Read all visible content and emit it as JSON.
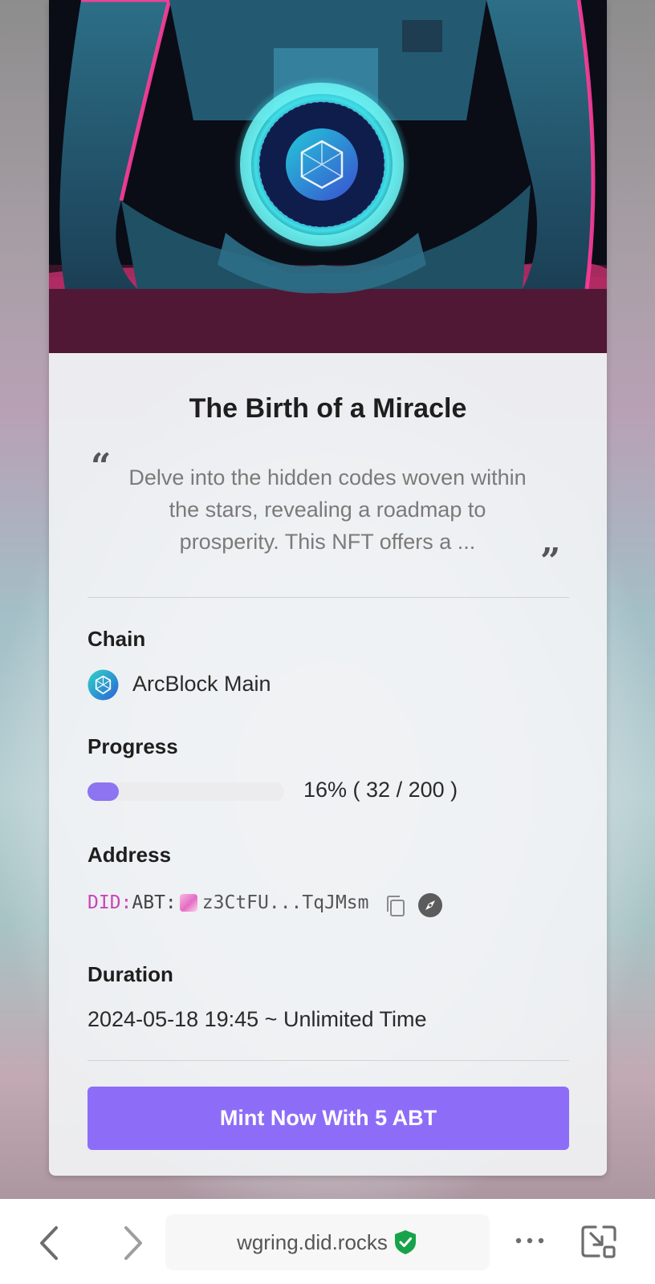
{
  "nft": {
    "title": "The Birth of a Miracle",
    "description": "Delve into the hidden codes woven within the stars, revealing a roadmap to prosperity. This NFT offers a ...",
    "quote_open": "“",
    "quote_close": "”"
  },
  "chain": {
    "label": "Chain",
    "name": "ArcBlock Main",
    "icon": "arcblock-logo-icon"
  },
  "progress": {
    "label": "Progress",
    "text": "16% ( 32 / 200 )",
    "minted": 32,
    "total": 200,
    "fraction": 0.16
  },
  "address": {
    "label": "Address",
    "prefix": "DID:",
    "type": "ABT:",
    "value": "z3CtFU...TqJMsm",
    "copy_icon": "copy-icon",
    "explore_icon": "compass-icon"
  },
  "duration": {
    "label": "Duration",
    "value": "2024-05-18 19:45 ~ Unlimited Time"
  },
  "actions": {
    "mint_label": "Mint Now With 5 ABT"
  },
  "browser": {
    "url": "wgring.did.rocks",
    "secure_icon": "shield-check-icon",
    "back_icon": "chevron-left-icon",
    "forward_icon": "chevron-right-icon",
    "more_icon": "more-horizontal-icon",
    "minimize_icon": "minimize-window-icon"
  },
  "colors": {
    "accent": "#8d6df8",
    "progress_fill": "#8e74f0",
    "did_prefix": "#c944b9",
    "secure": "#17a34a"
  }
}
